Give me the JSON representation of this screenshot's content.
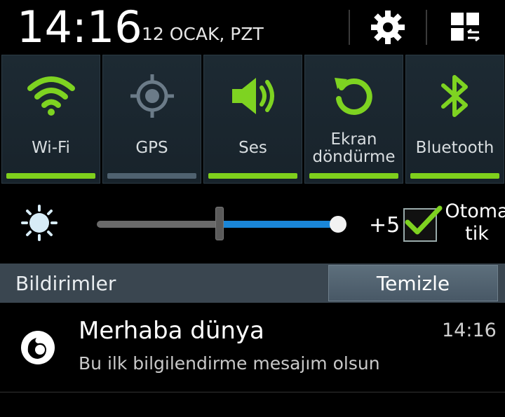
{
  "status": {
    "time": "14:16",
    "date": "12 OCAK, PZT"
  },
  "header_icons": [
    "gear-icon",
    "grid-settings-icon"
  ],
  "toggles": [
    {
      "label": "Wi-Fi",
      "icon": "wifi-icon",
      "on": true
    },
    {
      "label": "GPS",
      "icon": "gps-icon",
      "on": false
    },
    {
      "label": "Ses",
      "icon": "sound-icon",
      "on": true
    },
    {
      "label_line1": "Ekran",
      "label_line2": "döndürme",
      "icon": "rotate-icon",
      "on": true
    },
    {
      "label": "Bluetooth",
      "icon": "bluetooth-icon",
      "on": true
    }
  ],
  "brightness": {
    "level": 0.52,
    "value_label": "+5",
    "auto_line1": "Otoma",
    "auto_line2": "tik",
    "auto_checked": true
  },
  "notifications": {
    "header": "Bildirimler",
    "clear_label": "Temizle",
    "items": [
      {
        "title": "Merhaba dünya",
        "body": "Bu ilk bilgilendirme mesajım olsun",
        "time": "14:16",
        "icon": "firefox-icon"
      }
    ]
  },
  "colors": {
    "on": "#7ed321",
    "off": "#6b7b88",
    "bar_on": "#7fd01c",
    "bar_off": "#4f6270",
    "slider": "#1a86d8"
  }
}
